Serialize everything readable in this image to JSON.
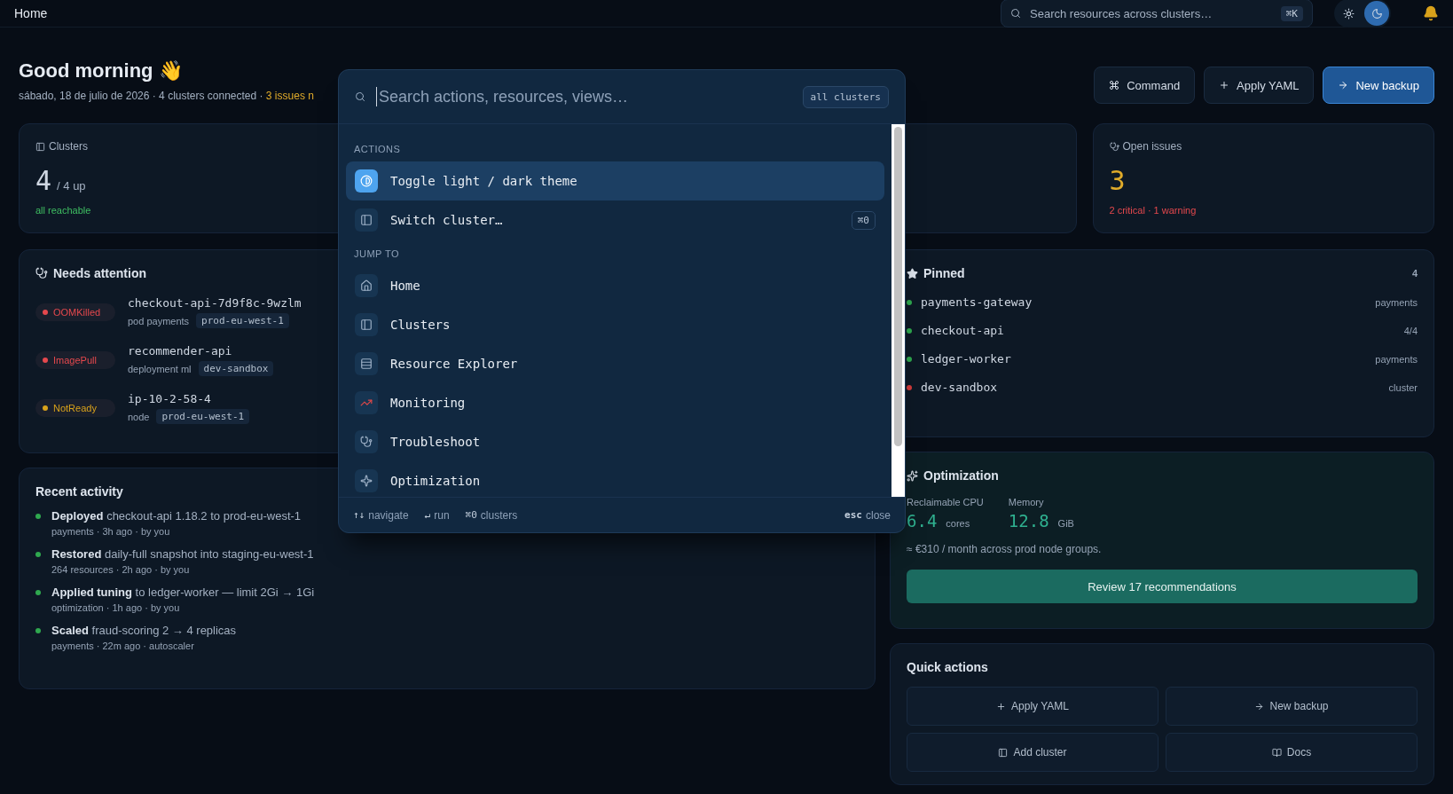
{
  "topbar": {
    "title": "Home",
    "search": {
      "placeholder": "Search resources across clusters…",
      "shortcut": "⌘K"
    },
    "theme_toggle": [
      {
        "selected": false
      },
      {
        "selected": true
      }
    ]
  },
  "header": {
    "greeting": "Good morning 👋",
    "subtitle": "sábado, 18 de julio de 2026 · 4 clusters connected · ",
    "subtitle_alert": "3 issues n",
    "buttons": [
      {
        "label": "Command",
        "primary": false
      },
      {
        "label": "Apply YAML",
        "primary": false
      },
      {
        "label": "New backup",
        "primary": true
      }
    ]
  },
  "stats": [
    {
      "label": "Clusters",
      "value": "4",
      "suffix": "/ 4 up",
      "note": "all reachable",
      "kind": "good"
    },
    {
      "label": "Open issues",
      "value": "3",
      "note": "2 critical · 1 warning",
      "kind": "bad"
    }
  ],
  "attention": {
    "title": "Needs attention",
    "items": [
      {
        "status": "OOMKilled",
        "color": "#e5484d",
        "name": "checkout-api-7d9f8c-9wzlm",
        "meta": "pod payments",
        "cluster": "prod-eu-west-1"
      },
      {
        "status": "ImagePull",
        "color": "#e5484d",
        "name": "recommender-api",
        "meta": "deployment ml",
        "cluster": "dev-sandbox"
      },
      {
        "status": "NotReady",
        "color": "#d9a21b",
        "name": "ip-10-2-58-4",
        "meta": "node",
        "cluster": "prod-eu-west-1"
      }
    ]
  },
  "activity": {
    "title": "Recent activity",
    "items": [
      {
        "text": "**Deployed** checkout-api 1.18.2 to prod-eu-west-1",
        "meta": "payments · 3h ago · by you"
      },
      {
        "text": "**Restored** daily-full snapshot into staging-eu-west-1",
        "meta": "264 resources · 2h ago · by you"
      },
      {
        "text": "**Applied tuning** to ledger-worker — limit 2Gi → 1Gi",
        "meta": "optimization · 1h ago · by you"
      },
      {
        "text": "**Scaled** fraud-scoring 2 → 4 replicas",
        "meta": "payments · 22m ago · autoscaler"
      }
    ]
  },
  "pinned": {
    "title": "Pinned",
    "count": "4",
    "items": [
      {
        "name": "payments-gateway",
        "detail": "payments",
        "color": "#2fa84f"
      },
      {
        "name": "checkout-api",
        "detail": "4/4",
        "color": "#2fa84f"
      },
      {
        "name": "ledger-worker",
        "detail": "payments",
        "color": "#2fa84f"
      },
      {
        "name": "dev-sandbox",
        "detail": "cluster",
        "color": "#d23b3b"
      }
    ]
  },
  "optimization": {
    "title": "Optimization",
    "metrics": [
      {
        "label": "Reclaimable CPU",
        "value": "6.4",
        "unit": "cores"
      },
      {
        "label": "Memory",
        "value": "12.8",
        "unit": "GiB"
      }
    ],
    "note": "≈ €310 / month across prod node groups.",
    "button": "Review 17 recommendations"
  },
  "quick_actions": {
    "title": "Quick actions",
    "buttons": [
      {
        "label": "Apply YAML"
      },
      {
        "label": "New backup"
      },
      {
        "label": "Add cluster"
      },
      {
        "label": "Docs"
      }
    ]
  },
  "palette": {
    "placeholder": "Search actions, resources, views…",
    "scope": "all clusters",
    "sections": [
      {
        "title": "ACTIONS",
        "items": [
          {
            "label": "Toggle light / dark theme",
            "selected": true
          },
          {
            "label": "Switch cluster…",
            "shortcut": "⌘0",
            "selected": false
          }
        ]
      },
      {
        "title": "JUMP TO",
        "items": [
          {
            "label": "Home",
            "selected": false
          },
          {
            "label": "Clusters",
            "selected": false
          },
          {
            "label": "Resource Explorer",
            "selected": false
          },
          {
            "label": "Monitoring",
            "selected": false
          },
          {
            "label": "Troubleshoot",
            "selected": false
          },
          {
            "label": "Optimization",
            "selected": false
          }
        ]
      }
    ],
    "footer": [
      {
        "key": "↑↓",
        "label": "navigate"
      },
      {
        "key": "↵",
        "label": "run"
      },
      {
        "key": "⌘0",
        "label": "clusters"
      },
      {
        "key": "esc",
        "label": "close",
        "kind": "trailing"
      }
    ]
  }
}
